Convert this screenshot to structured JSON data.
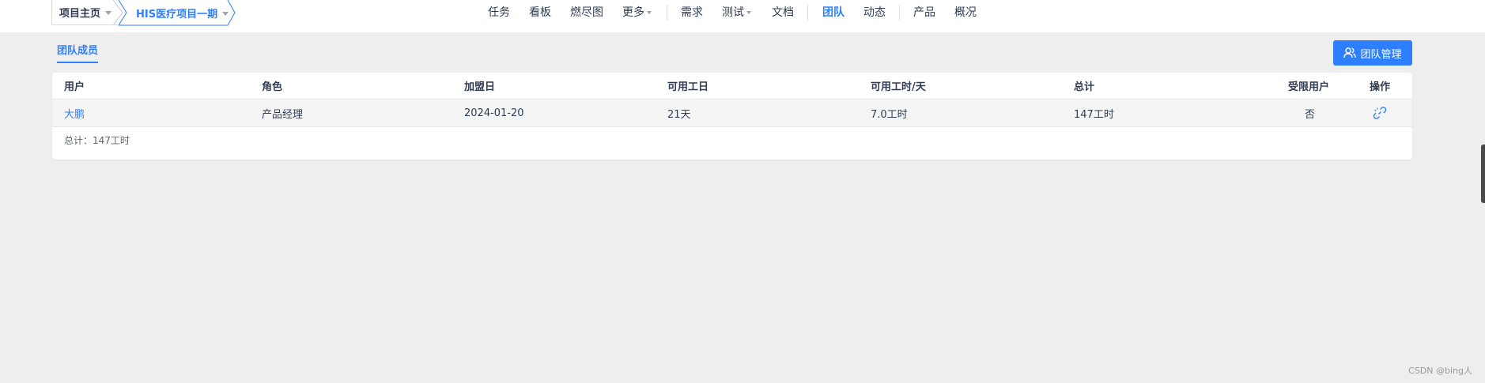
{
  "breadcrumb": {
    "home": "项目主页",
    "project": "HIS医疗项目一期"
  },
  "nav": {
    "items": [
      {
        "label": "任务"
      },
      {
        "label": "看板"
      },
      {
        "label": "燃尽图"
      },
      {
        "label": "更多"
      },
      {
        "label": "需求"
      },
      {
        "label": "测试"
      },
      {
        "label": "文档"
      },
      {
        "label": "团队"
      },
      {
        "label": "动态"
      },
      {
        "label": "产品"
      },
      {
        "label": "概况"
      }
    ],
    "active": "团队"
  },
  "subheader": {
    "tab": "团队成员",
    "manage_button": "团队管理"
  },
  "table": {
    "columns": [
      "用户",
      "角色",
      "加盟日",
      "可用工日",
      "可用工时/天",
      "总计",
      "受限用户",
      "操作"
    ],
    "rows": [
      {
        "user": "大鹏",
        "role": "产品经理",
        "join_date": "2024-01-20",
        "available_days": "21天",
        "hours_per_day": "7.0工时",
        "total": "147工时",
        "restricted": "否",
        "action_icon": "unlink-icon"
      }
    ],
    "summary": "总计：147工时"
  },
  "watermark": "CSDN @bing人",
  "colors": {
    "primary": "#2e7fff",
    "background": "#eeeeee",
    "text": "#313c52"
  }
}
